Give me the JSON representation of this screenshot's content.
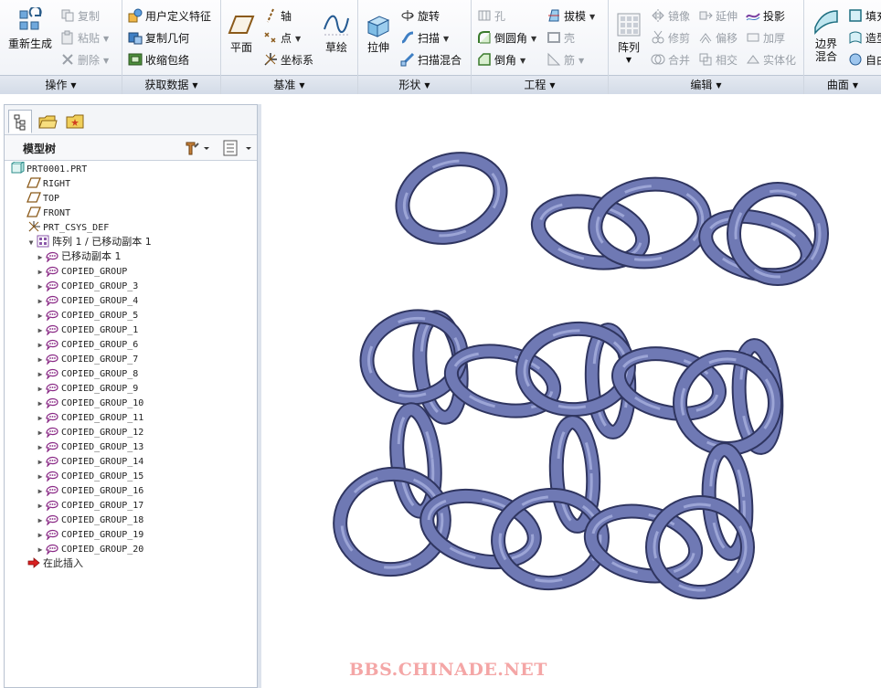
{
  "ribbon": {
    "groups": {
      "operations": "操作",
      "get_data": "获取数据",
      "datum": "基准",
      "shapes": "形状",
      "engineering": "工程",
      "editing": "编辑",
      "surfaces": "曲面"
    },
    "buttons": {
      "regenerate": "重新生成",
      "copy": "复制",
      "paste": "粘贴",
      "delete": "删除",
      "user_defined_feature": "用户定义特征",
      "copy_geometry": "复制几何",
      "shrinkwrap": "收缩包络",
      "plane": "平面",
      "axis": "轴",
      "point": "点",
      "csys": "坐标系",
      "sketch": "草绘",
      "extrude": "拉伸",
      "revolve": "旋转",
      "sweep": "扫描",
      "swept_blend": "扫描混合",
      "hole": "孔",
      "round": "倒圆角",
      "chamfer": "倒角",
      "draft": "拔模",
      "shell": "壳",
      "rib": "筋",
      "pattern": "阵列",
      "mirror": "镜像",
      "trim": "修剪",
      "merge": "合并",
      "extend": "延伸",
      "offset": "偏移",
      "intersect": "相交",
      "project": "投影",
      "thicken": "加厚",
      "solidify": "实体化",
      "boundary_blend_1": "边界",
      "boundary_blend_2": "混合",
      "fill": "填充",
      "style": "造型",
      "freestyle": "自由式"
    }
  },
  "model_tree": {
    "title": "模型树",
    "items": [
      {
        "label": "PRT0001.PRT",
        "icon": "part-icon",
        "level": 0
      },
      {
        "label": "RIGHT",
        "icon": "datum-plane-icon",
        "level": 1
      },
      {
        "label": "TOP",
        "icon": "datum-plane-icon",
        "level": 1
      },
      {
        "label": "FRONT",
        "icon": "datum-plane-icon",
        "level": 1
      },
      {
        "label": "PRT_CSYS_DEF",
        "icon": "csys-icon",
        "level": 1
      },
      {
        "label": "阵列 1 / 已移动副本 1",
        "icon": "pattern-icon",
        "level": 1,
        "expanded": true
      },
      {
        "label": "已移动副本 1",
        "icon": "group-icon",
        "level": 2
      },
      {
        "label": "COPIED_GROUP",
        "icon": "group-icon",
        "level": 2
      },
      {
        "label": "COPIED_GROUP_3",
        "icon": "group-icon",
        "level": 2
      },
      {
        "label": "COPIED_GROUP_4",
        "icon": "group-icon",
        "level": 2
      },
      {
        "label": "COPIED_GROUP_5",
        "icon": "group-icon",
        "level": 2
      },
      {
        "label": "COPIED_GROUP_1",
        "icon": "group-icon",
        "level": 2
      },
      {
        "label": "COPIED_GROUP_6",
        "icon": "group-icon",
        "level": 2
      },
      {
        "label": "COPIED_GROUP_7",
        "icon": "group-icon",
        "level": 2
      },
      {
        "label": "COPIED_GROUP_8",
        "icon": "group-icon",
        "level": 2
      },
      {
        "label": "COPIED_GROUP_9",
        "icon": "group-icon",
        "level": 2
      },
      {
        "label": "COPIED_GROUP_10",
        "icon": "group-icon",
        "level": 2
      },
      {
        "label": "COPIED_GROUP_11",
        "icon": "group-icon",
        "level": 2
      },
      {
        "label": "COPIED_GROUP_12",
        "icon": "group-icon",
        "level": 2
      },
      {
        "label": "COPIED_GROUP_13",
        "icon": "group-icon",
        "level": 2
      },
      {
        "label": "COPIED_GROUP_14",
        "icon": "group-icon",
        "level": 2
      },
      {
        "label": "COPIED_GROUP_15",
        "icon": "group-icon",
        "level": 2
      },
      {
        "label": "COPIED_GROUP_16",
        "icon": "group-icon",
        "level": 2
      },
      {
        "label": "COPIED_GROUP_17",
        "icon": "group-icon",
        "level": 2
      },
      {
        "label": "COPIED_GROUP_18",
        "icon": "group-icon",
        "level": 2
      },
      {
        "label": "COPIED_GROUP_19",
        "icon": "group-icon",
        "level": 2
      },
      {
        "label": "COPIED_GROUP_20",
        "icon": "group-icon",
        "level": 2
      },
      {
        "label": "在此插入",
        "icon": "insert-here-icon",
        "level": 1
      }
    ]
  },
  "viewport": {
    "watermark": "BBS.CHINADE.NET"
  },
  "colors": {
    "ring_fill": "#6f79b4",
    "ring_edge": "#2f3560",
    "ring_highlight": "#a7b0de",
    "watermark": "#f4a6a6"
  }
}
